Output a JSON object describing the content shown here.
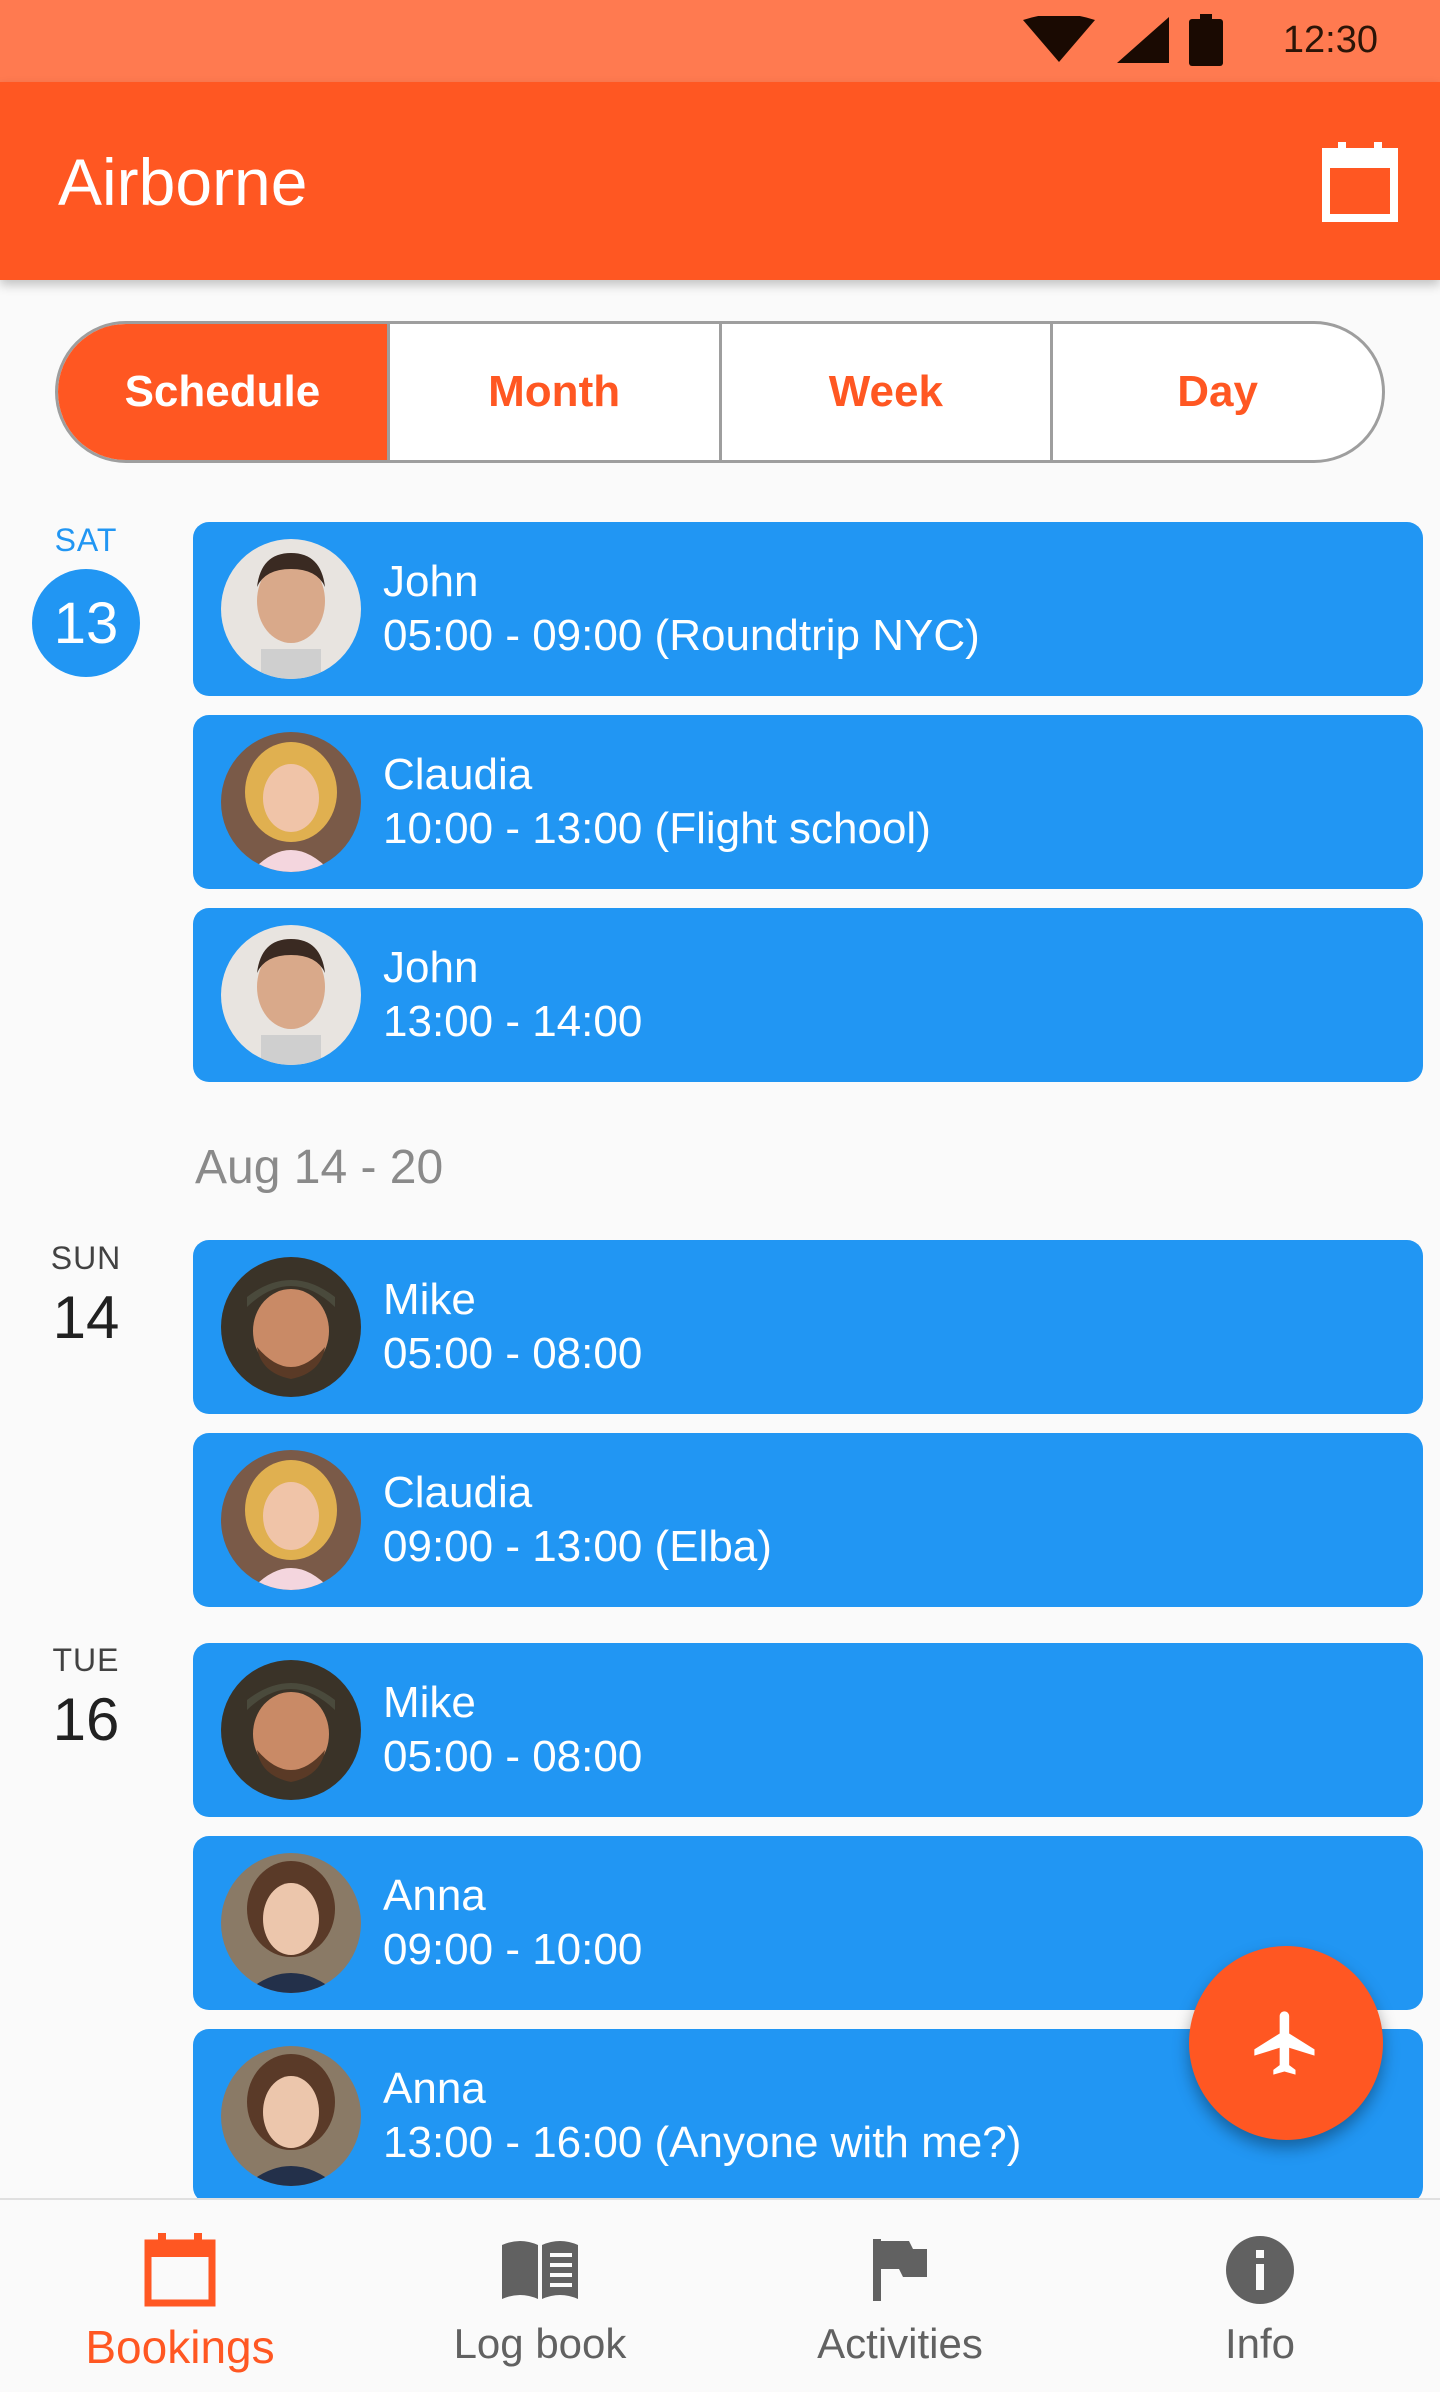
{
  "status": {
    "time": "12:30"
  },
  "app": {
    "title": "Airborne"
  },
  "segments": [
    {
      "label": "Schedule",
      "active": true
    },
    {
      "label": "Month",
      "active": false
    },
    {
      "label": "Week",
      "active": false
    },
    {
      "label": "Day",
      "active": false
    }
  ],
  "days": [
    {
      "name": "SAT",
      "num": "13",
      "today": true
    },
    {
      "name": "SUN",
      "num": "14",
      "today": false
    },
    {
      "name": "TUE",
      "num": "16",
      "today": false
    }
  ],
  "week_header": "Aug 14 - 20",
  "events": [
    {
      "name": "John",
      "time": "05:00 - 09:00 (Roundtrip NYC)"
    },
    {
      "name": "Claudia",
      "time": "10:00 - 13:00 (Flight school)"
    },
    {
      "name": "John",
      "time": "13:00 - 14:00"
    },
    {
      "name": "Mike",
      "time": "05:00 - 08:00"
    },
    {
      "name": "Claudia",
      "time": "09:00 - 13:00 (Elba)"
    },
    {
      "name": "Mike",
      "time": "05:00 - 08:00"
    },
    {
      "name": "Anna",
      "time": "09:00 - 10:00"
    },
    {
      "name": "Anna",
      "time": "13:00 - 16:00 (Anyone with me?)"
    }
  ],
  "nav": [
    {
      "label": "Bookings",
      "icon": "calendar-icon",
      "active": true
    },
    {
      "label": "Log book",
      "icon": "book-icon",
      "active": false
    },
    {
      "label": "Activities",
      "icon": "flag-icon",
      "active": false
    },
    {
      "label": "Info",
      "icon": "info-icon",
      "active": false
    }
  ],
  "colors": {
    "primary": "#ff5722",
    "status_bar": "#ff7a50",
    "event": "#2196f3"
  }
}
